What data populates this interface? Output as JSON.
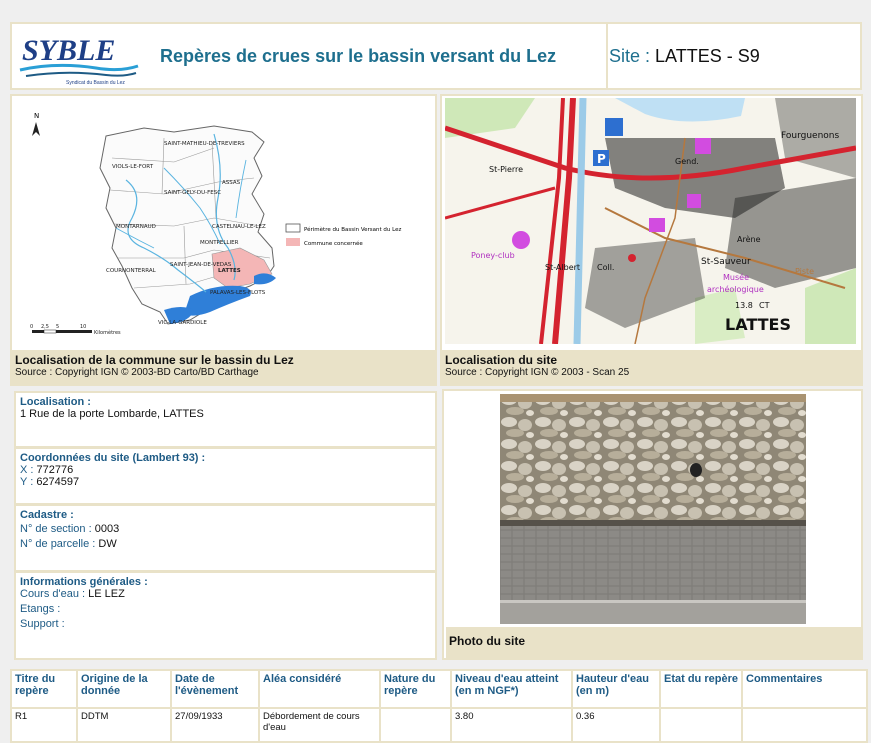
{
  "header": {
    "logo_text": "SYBLE",
    "logo_subtitle": "Syndicat du Bassin du Lez",
    "title": "Repères de crues sur le bassin versant du Lez",
    "site_label": "Site : ",
    "site_value": "LATTES - S9"
  },
  "map_left": {
    "north": "N",
    "towns": [
      "SAINT-MATHIEU-DE-TREVIERS",
      "VIOLS-LE-FORT",
      "SAINT-GELY-DU-FESC",
      "ASSAS",
      "MONTARNAUD",
      "CASTELNAU-LE-LEZ",
      "MONTPELLIER",
      "COURNONTERRAL",
      "SAINT-JEAN-DE-VEDAS",
      "LATTES",
      "PALAVAS-LES-FLOTS",
      "VIC-LA-GARDIOLE"
    ],
    "legend": [
      "Périmètre du Bassin Versant du Lez",
      "Commune concernée"
    ],
    "scale": [
      "0",
      "2,5",
      "5",
      "10",
      "Kilomètres"
    ],
    "caption_title": "Localisation de la commune sur le bassin du Lez",
    "caption_source": "Source : Copyright IGN © 2003-BD Carto/BD Carthage"
  },
  "map_right": {
    "labels": [
      "St-Pierre",
      "Poney-club",
      "St-Albert",
      "Coll.",
      "Gend.",
      "Arène",
      "St-Sauveur",
      "Musée",
      "archéologique",
      "Piste",
      "13.8",
      "CT",
      "LATTES",
      "Fourguenons"
    ],
    "caption_title": "Localisation du site",
    "caption_source": "Source : Copyright IGN © 2003 - Scan 25"
  },
  "info": {
    "localisation_label": "Localisation :",
    "localisation_value": "1 Rue de la porte Lombarde, LATTES",
    "coords_label": "Coordonnées du site (Lambert 93) :",
    "x_key": "X : ",
    "x_value": "772776",
    "y_key": "Y : ",
    "y_value": "6274597",
    "cadastre_label": "Cadastre :",
    "section_key": "N° de section : ",
    "section_value": "0003",
    "parcelle_key": "N° de parcelle : ",
    "parcelle_value": "DW",
    "general_label": "Informations générales :",
    "cours_key": "Cours d'eau : ",
    "cours_value": "LE LEZ",
    "etangs_key": "Etangs :",
    "support_key": "Support :"
  },
  "photo": {
    "caption": "Photo du site"
  },
  "table": {
    "headers": [
      "Titre du repère",
      "Origine de la donnée",
      "Date de l'évènement",
      "Aléa considéré",
      "Nature du repère",
      "Niveau d'eau atteint (en m NGF*)",
      "Hauteur d'eau (en m)",
      "Etat du repère",
      "Commentaires"
    ],
    "rows": [
      [
        "R1",
        "DDTM",
        "27/09/1933",
        "Débordement de cours d'eau",
        "",
        "3.80",
        "0.36",
        "",
        ""
      ]
    ]
  },
  "colors": {
    "accent": "#1e6f8e",
    "label": "#1e5b85",
    "panel_border": "#e9e2c8",
    "commune": "#f4b6b6"
  }
}
